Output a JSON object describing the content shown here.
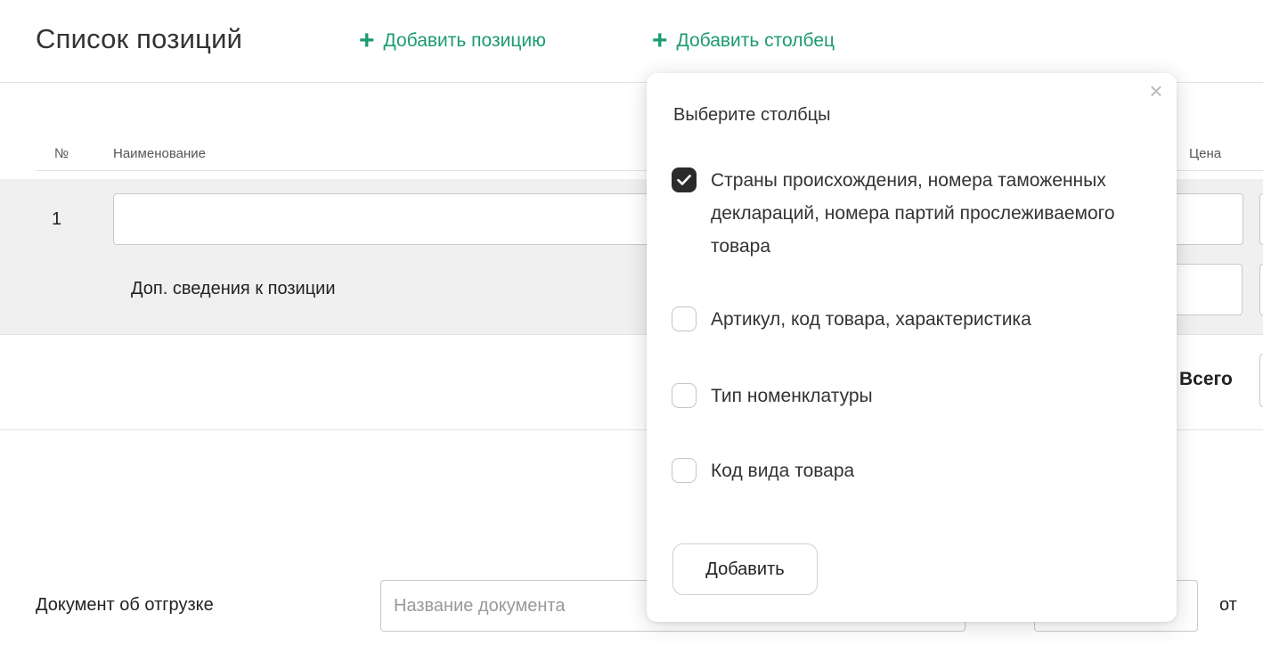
{
  "header": {
    "title": "Список позиций",
    "add_position": "Добавить позицию",
    "add_column": "Добавить столбец"
  },
  "table": {
    "columns": {
      "number": "№",
      "name": "Наименование",
      "price": "Цена"
    },
    "rows": [
      {
        "number": "1",
        "name": "",
        "extra_info_label": "Доп. сведения к позиции"
      }
    ],
    "total_label": "Всего"
  },
  "shipment": {
    "label": "Документ об отгрузке",
    "name_placeholder": "Название документа",
    "name_value": "",
    "date_prefix": "от"
  },
  "popup": {
    "title": "Выберите столбцы",
    "options": [
      {
        "label": "Страны происхождения, номера таможенных деклараций, номера партий прослеживаемого товара",
        "checked": true
      },
      {
        "label": "Артикул, код товара, характеристика",
        "checked": false
      },
      {
        "label": "Тип номенклатуры",
        "checked": false
      },
      {
        "label": "Код вида товара",
        "checked": false
      }
    ],
    "submit": "Добавить"
  },
  "colors": {
    "accent": "#1b9a73",
    "checkbox_checked": "#2b2b2b",
    "row_bg": "#f0f0f0"
  }
}
